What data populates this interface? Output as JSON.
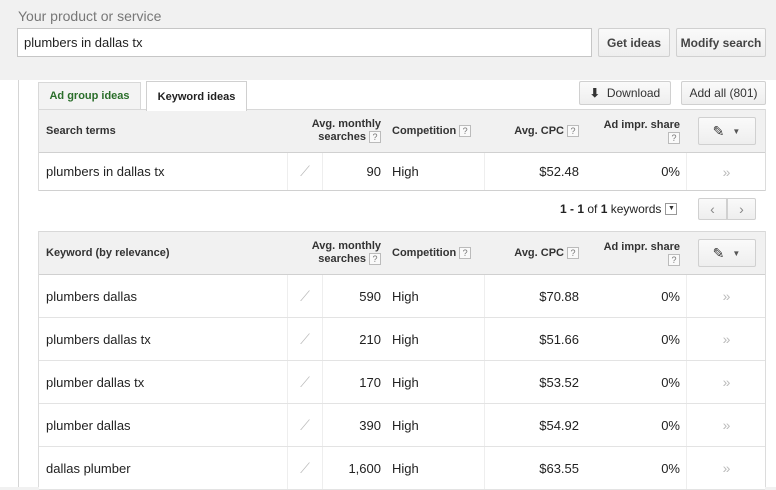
{
  "search": {
    "label": "Your product or service",
    "value": "plumbers in dallas tx",
    "get_ideas": "Get ideas",
    "modify_search": "Modify search"
  },
  "tabs": [
    {
      "label": "Ad group ideas",
      "active": false
    },
    {
      "label": "Keyword ideas",
      "active": true
    }
  ],
  "toolbar": {
    "download": "Download",
    "add_all": "Add all (801)"
  },
  "columns": {
    "search_terms": "Search terms",
    "keyword_by_relevance": "Keyword (by relevance)",
    "avg_monthly_1": "Avg. monthly",
    "avg_monthly_2": "searches",
    "competition": "Competition",
    "avg_cpc": "Avg. CPC",
    "ad_impr_1": "Ad impr. share",
    "help": "?"
  },
  "search_terms_rows": [
    {
      "term": "plumbers in dallas tx",
      "searches": "90",
      "competition": "High",
      "cpc": "$52.48",
      "impr": "0%"
    }
  ],
  "pagination": {
    "range": "1 - 1",
    "of": "of",
    "total": "1",
    "unit": "keywords",
    "prev": "‹",
    "next": "›"
  },
  "keyword_rows": [
    {
      "term": "plumbers dallas",
      "searches": "590",
      "competition": "High",
      "cpc": "$70.88",
      "impr": "0%"
    },
    {
      "term": "plumbers dallas tx",
      "searches": "210",
      "competition": "High",
      "cpc": "$51.66",
      "impr": "0%"
    },
    {
      "term": "plumber dallas tx",
      "searches": "170",
      "competition": "High",
      "cpc": "$53.52",
      "impr": "0%"
    },
    {
      "term": "plumber dallas",
      "searches": "390",
      "competition": "High",
      "cpc": "$54.92",
      "impr": "0%"
    },
    {
      "term": "dallas plumber",
      "searches": "1,600",
      "competition": "High",
      "cpc": "$63.55",
      "impr": "0%"
    }
  ],
  "icons": {
    "trend": "trend-chart-icon",
    "add": "double-chevron-right-icon",
    "edit": "pencil-icon",
    "download": "download-arrow-icon"
  },
  "colors": {
    "ad_group_tab_text": "#2a6e2a",
    "header_bg": "#f1f1f1"
  }
}
